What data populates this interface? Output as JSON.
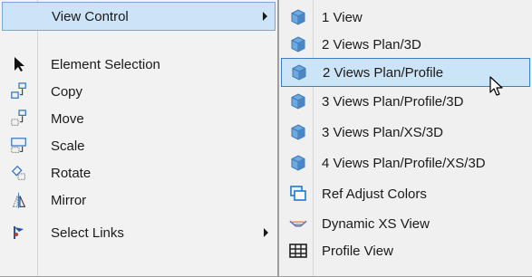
{
  "main_menu": {
    "items": [
      {
        "label": "View Control",
        "icon": "",
        "submenu": true
      },
      {
        "label": "Element Selection",
        "icon": "arrow-pointer-icon"
      },
      {
        "label": "Copy",
        "icon": "copy-element-icon"
      },
      {
        "label": "Move",
        "icon": "move-element-icon"
      },
      {
        "label": "Scale",
        "icon": "scale-element-icon"
      },
      {
        "label": "Rotate",
        "icon": "rotate-element-icon"
      },
      {
        "label": "Mirror",
        "icon": "mirror-element-icon"
      },
      {
        "label": "Select Links",
        "icon": "select-links-icon",
        "submenu": true
      }
    ]
  },
  "sub_menu": {
    "items": [
      {
        "label": "1 View",
        "icon": "view-cube-icon"
      },
      {
        "label": "2 Views Plan/3D",
        "icon": "view-cube-icon"
      },
      {
        "label": "2 Views Plan/Profile",
        "icon": "view-cube-icon"
      },
      {
        "label": "3 Views Plan/Profile/3D",
        "icon": "view-cube-icon"
      },
      {
        "label": "3 Views Plan/XS/3D",
        "icon": "view-cube-icon"
      },
      {
        "label": "4 Views Plan/Profile/XS/3D",
        "icon": "view-cube-icon"
      },
      {
        "label": "Ref Adjust Colors",
        "icon": "ref-adjust-colors-icon"
      },
      {
        "label": "Dynamic XS View",
        "icon": "dynamic-xs-view-icon"
      },
      {
        "label": "Profile View",
        "icon": "profile-view-grid-icon"
      }
    ]
  },
  "colors": {
    "highlight_bg": "#cde3f7",
    "highlight_border": "#3d7dca",
    "menu_bg": "#f2f2f2"
  }
}
